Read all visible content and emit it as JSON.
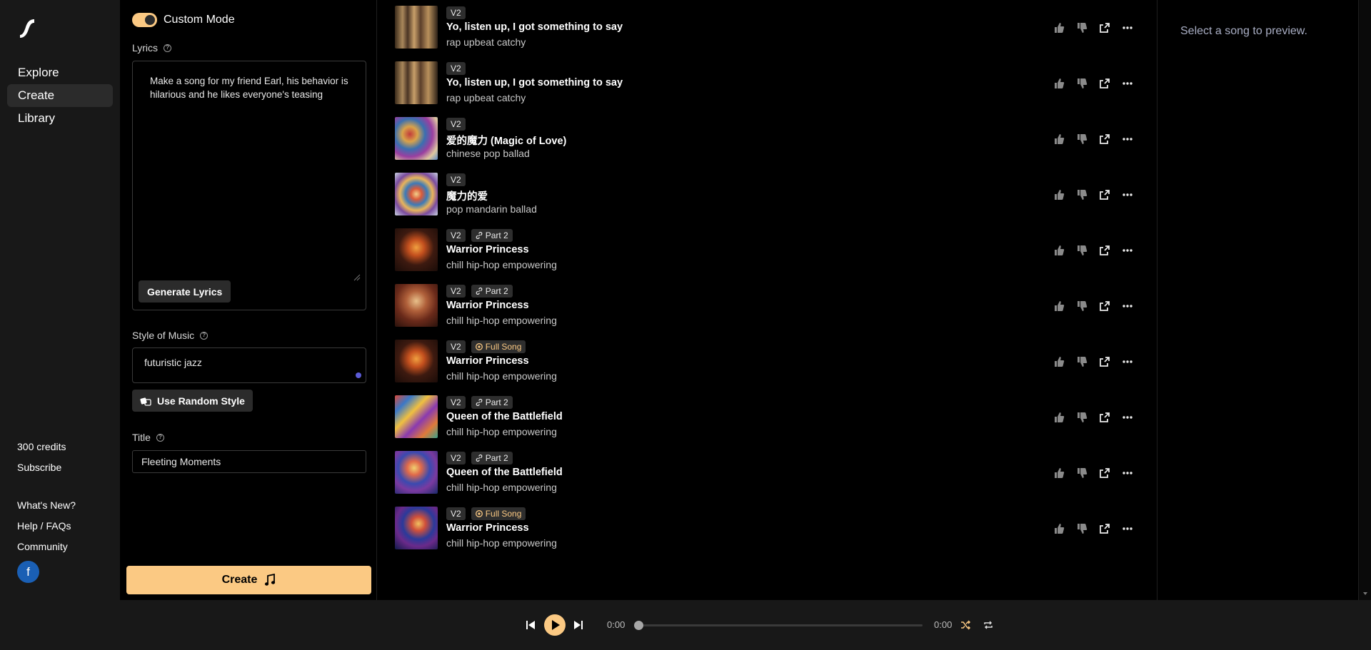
{
  "nav": {
    "items": [
      "Explore",
      "Create",
      "Library"
    ],
    "credits": "300 credits",
    "subscribe": "Subscribe",
    "whats_new": "What's New?",
    "help": "Help / FAQs",
    "community": "Community",
    "avatar_letter": "f"
  },
  "create": {
    "custom_mode": "Custom Mode",
    "lyrics_label": "Lyrics",
    "lyrics_value": "Make a song for my friend Earl, his behavior is hilarious and he likes everyone's teasing",
    "generate_lyrics": "Generate Lyrics",
    "style_label": "Style of Music",
    "style_value": "futuristic jazz",
    "random_style": "Use Random Style",
    "title_label": "Title",
    "title_value": "Fleeting Moments",
    "create_button": "Create"
  },
  "songs": [
    {
      "version": "V2",
      "extra": "",
      "title": "Yo, listen up, I got something to say",
      "tags": "rap upbeat catchy"
    },
    {
      "version": "V2",
      "extra": "",
      "title": "Yo, listen up, I got something to say",
      "tags": "rap upbeat catchy"
    },
    {
      "version": "V2",
      "extra": "",
      "title": "爱的魔力 (Magic of Love)",
      "tags": "chinese pop ballad"
    },
    {
      "version": "V2",
      "extra": "",
      "title": "魔力的爱",
      "tags": "pop mandarin ballad"
    },
    {
      "version": "V2",
      "extra": "Part 2",
      "title": "Warrior Princess",
      "tags": "chill hip-hop empowering"
    },
    {
      "version": "V2",
      "extra": "Part 2",
      "title": "Warrior Princess",
      "tags": "chill hip-hop empowering"
    },
    {
      "version": "V2",
      "extra": "Full Song",
      "title": "Warrior Princess",
      "tags": "chill hip-hop empowering"
    },
    {
      "version": "V2",
      "extra": "Part 2",
      "title": "Queen of the Battlefield",
      "tags": "chill hip-hop empowering"
    },
    {
      "version": "V2",
      "extra": "Part 2",
      "title": "Queen of the Battlefield",
      "tags": "chill hip-hop empowering"
    },
    {
      "version": "V2",
      "extra": "Full Song",
      "title": "Warrior Princess",
      "tags": "chill hip-hop empowering"
    }
  ],
  "preview": {
    "empty_text": "Select a song to preview."
  },
  "player": {
    "current_time": "0:00",
    "duration": "0:00",
    "progress": 0
  },
  "colors": {
    "accent": "#fbc983",
    "panel": "#181818",
    "muted": "#a9aec4"
  }
}
